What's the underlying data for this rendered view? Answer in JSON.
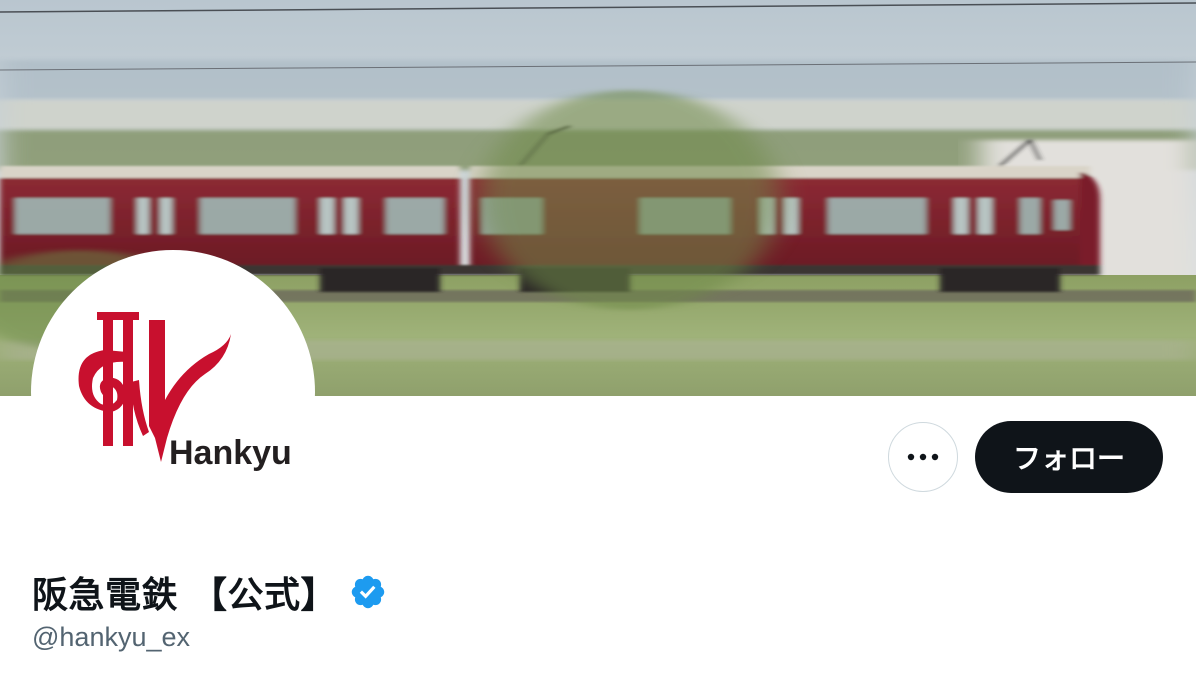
{
  "profile": {
    "display_name": "阪急電鉄 【公式】",
    "handle": "@hankyu_ex",
    "verified": true,
    "avatar_logo_text": "Hankyu"
  },
  "actions": {
    "follow_label": "フォロー"
  },
  "icons": {
    "more": "more-horizontal-icon",
    "verified": "verified-badge-icon"
  },
  "colors": {
    "follow_button": "#0f1419",
    "verified_badge": "#1d9bf0",
    "logo_red": "#c8102e",
    "train_maroon": "#7a1f2a"
  }
}
